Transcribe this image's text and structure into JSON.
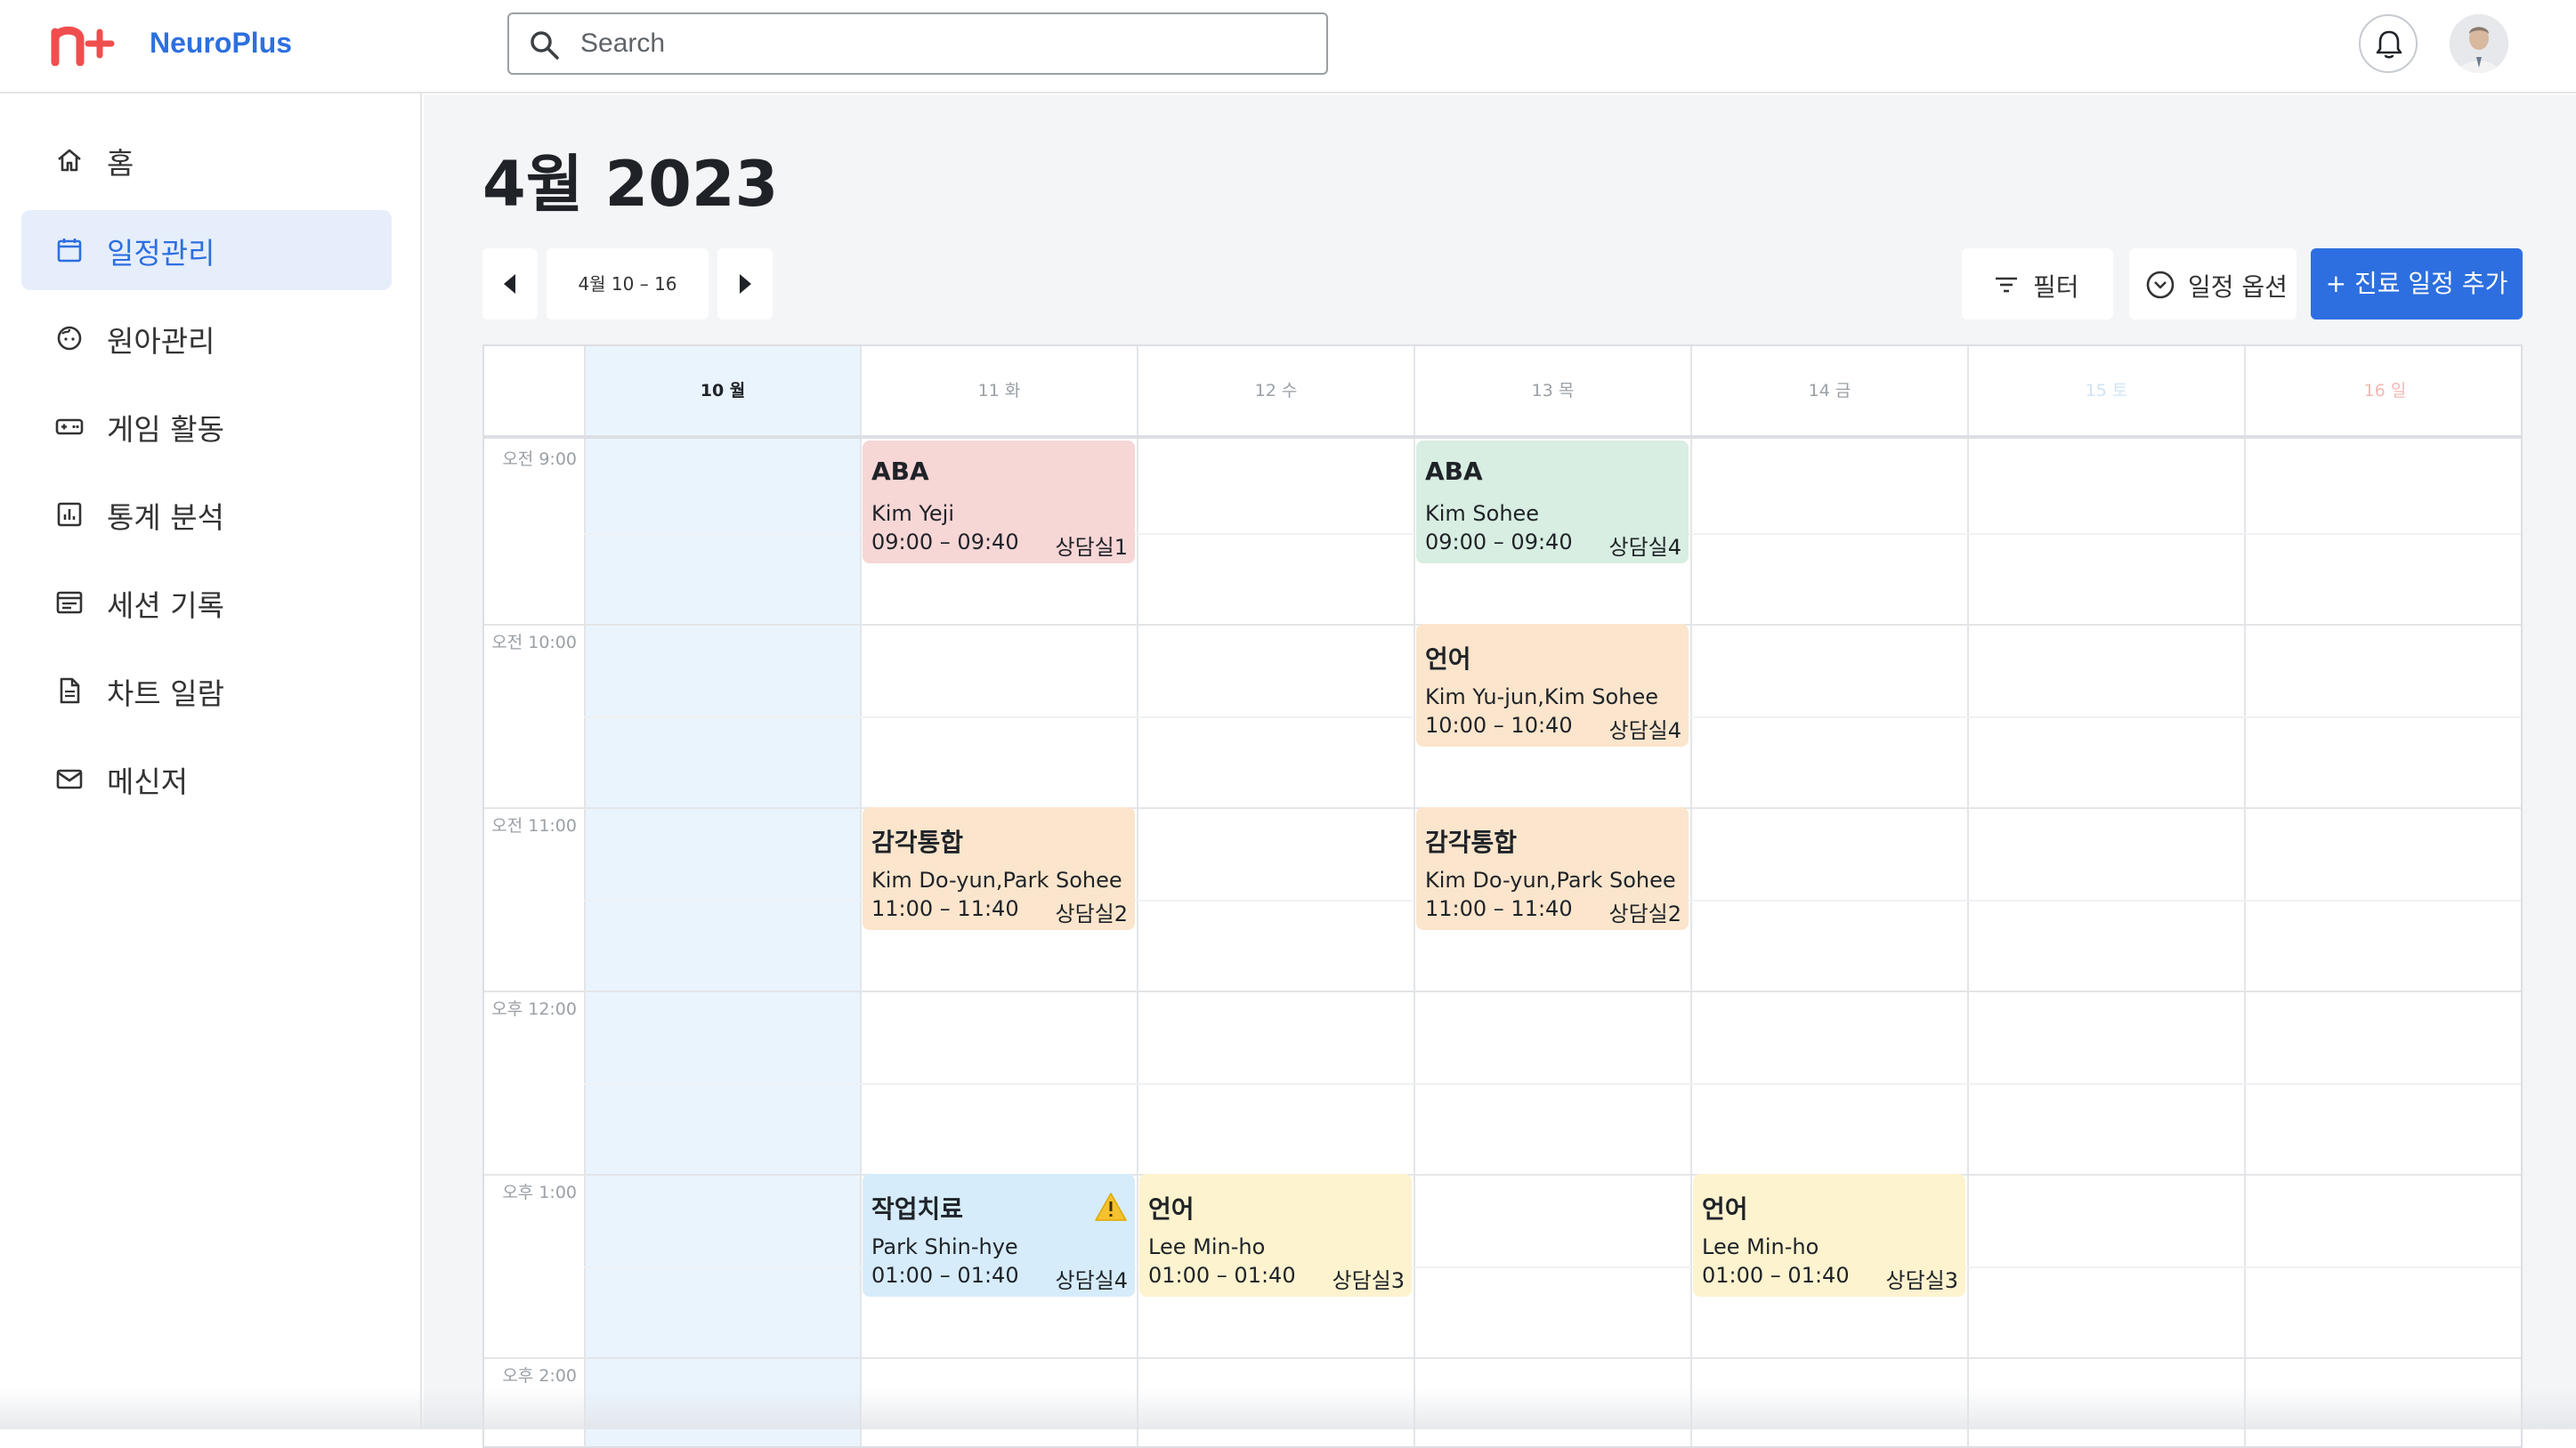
{
  "app": {
    "name": "NeuroPlus",
    "brand_color": "#2d6fe0",
    "logo_color": "#f04e4e"
  },
  "search": {
    "placeholder": "Search",
    "value": ""
  },
  "sidebar": {
    "items": [
      {
        "label": "홈",
        "icon": "home-icon"
      },
      {
        "label": "일정관리",
        "icon": "calendar-icon",
        "active": true
      },
      {
        "label": "원아관리",
        "icon": "child-face-icon"
      },
      {
        "label": "게임 활동",
        "icon": "gamepad-icon"
      },
      {
        "label": "통계 분석",
        "icon": "bar-chart-icon"
      },
      {
        "label": "세션 기록",
        "icon": "session-record-icon"
      },
      {
        "label": "차트 일람",
        "icon": "document-icon"
      },
      {
        "label": "메신저",
        "icon": "mail-icon"
      }
    ]
  },
  "main": {
    "title": "4월 2023",
    "week_range": "4월 10 – 16",
    "filter_label": "필터",
    "options_label": "일정 옵션",
    "add_label": "+ 진료 일정 추가"
  },
  "calendar": {
    "days": [
      {
        "label": "10 월",
        "today": true
      },
      {
        "label": "11 화"
      },
      {
        "label": "12 수"
      },
      {
        "label": "13 목"
      },
      {
        "label": "14 금"
      },
      {
        "label": "15 토",
        "weekend": "sat"
      },
      {
        "label": "16 일",
        "weekend": "sun"
      }
    ],
    "times": [
      "오전 9:00",
      "오전 10:00",
      "오전 11:00",
      "오후 12:00",
      "오후 1:00",
      "오후 2:00"
    ],
    "events": [
      {
        "title": "ABA",
        "people": "Kim Yeji",
        "time": "09:00 – 09:40",
        "room": "상담실1",
        "color": "pink",
        "day": "11 화"
      },
      {
        "title": "ABA",
        "people": "Kim Sohee",
        "time": "09:00 – 09:40",
        "room": "상담실4",
        "color": "green",
        "day": "13 목"
      },
      {
        "title": "언어",
        "people": "Kim Yu-jun,Kim Sohee",
        "time": "10:00 – 10:40",
        "room": "상담실4",
        "color": "orange",
        "day": "13 목"
      },
      {
        "title": "감각통합",
        "people": "Kim Do-yun,Park Sohee",
        "time": "11:00 – 11:40",
        "room": "상담실2",
        "color": "orange",
        "day": "11 화"
      },
      {
        "title": "감각통합",
        "people": "Kim Do-yun,Park Sohee",
        "time": "11:00 – 11:40",
        "room": "상담실2",
        "color": "orange",
        "day": "13 목"
      },
      {
        "title": "작업치료",
        "people": "Park Shin-hye",
        "time": "01:00 – 01:40",
        "room": "상담실4",
        "color": "blue",
        "day": "11 화",
        "warning": true
      },
      {
        "title": "언어",
        "people": "Lee Min-ho",
        "time": "01:00 – 01:40",
        "room": "상담실3",
        "color": "yellow",
        "day": "12 수"
      },
      {
        "title": "언어",
        "people": "Lee Min-ho",
        "time": "01:00 – 01:40",
        "room": "상담실3",
        "color": "yellow",
        "day": "14 금"
      }
    ]
  }
}
